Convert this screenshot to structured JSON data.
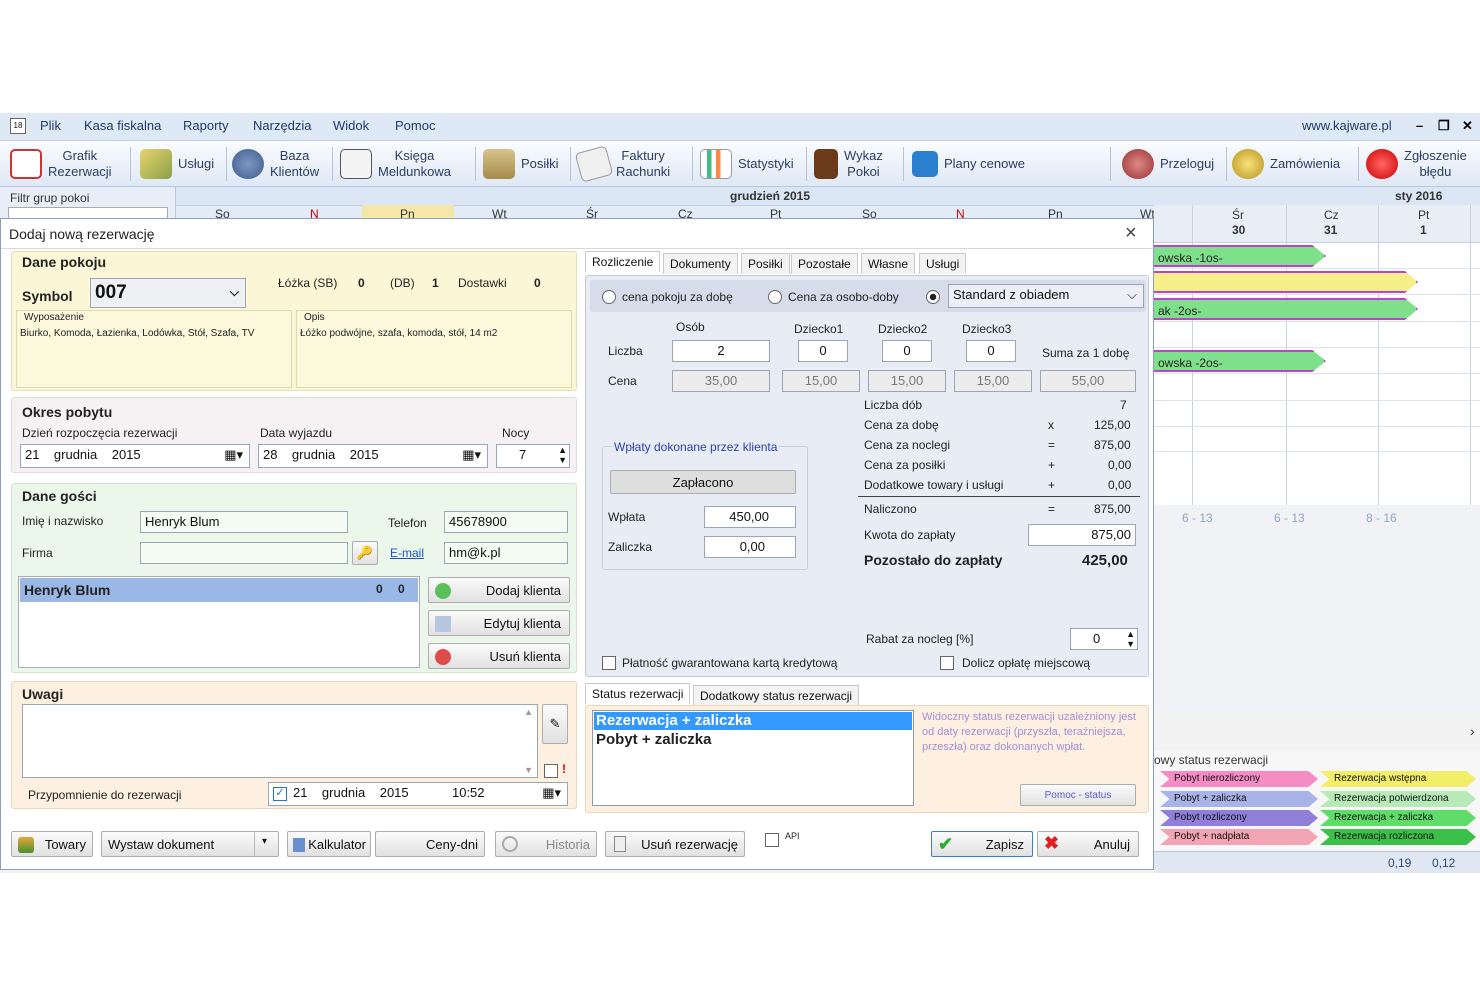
{
  "menu": {
    "items": [
      "Plik",
      "Kasa fiskalna",
      "Raporty",
      "Narzędzia",
      "Widok",
      "Pomoc"
    ],
    "site": "www.kajware.pl"
  },
  "toolbar": {
    "grafik": "Grafik\nRezerwacji",
    "uslugi": "Usługi",
    "baza": "Baza\nKlientów",
    "ksiega": "Księga\nMeldunkowa",
    "posilki": "Posiłki",
    "faktury": "Faktury\nRachunki",
    "statystyki": "Statystyki",
    "wykaz": "Wykaz\nPokoi",
    "plany": "Plany cenowe",
    "przeloguj": "Przeloguj",
    "zamowienia": "Zamówienia",
    "zgloszenie": "Zgłoszenie\nbłędu"
  },
  "calendar": {
    "filter_label": "Filtr grup pokoi",
    "month1": "grudzień 2015",
    "month2": "sty 2016",
    "days": [
      {
        "n": "Śr",
        "d": "30"
      },
      {
        "n": "Cz",
        "d": "31"
      },
      {
        "n": "Pt",
        "d": "1"
      }
    ],
    "top_days": [
      "So",
      "N",
      "Pn",
      "Wt",
      "Śr",
      "Cz",
      "Pt",
      "So",
      "N",
      "Pn",
      "Wt"
    ],
    "bars": [
      "owska -1os-",
      "ak -2os-",
      "owska -2os-"
    ],
    "ranges": [
      "6 - 13",
      "6 - 13",
      "8 - 16"
    ],
    "status_label": "owy status rezerwacji",
    "legend_left": [
      "Pobyt nierozliczony",
      "Pobyt + zaliczka",
      "Pobyt rozliczony",
      "Pobyt + nadpłata"
    ],
    "legend_right": [
      "Rezerwacja wstępna",
      "Rezerwacja potwierdzona",
      "Rezerwacja + zaliczka",
      "Rezerwacja rozliczona"
    ],
    "bottom_vals": [
      "0,19",
      "0,12"
    ]
  },
  "dialog": {
    "title": "Dodaj nową rezerwację",
    "room": {
      "title": "Dane pokoju",
      "symbol_label": "Symbol",
      "symbol": "007",
      "lozka_sb_label": "Łóżka (SB)",
      "lozka_sb": "0",
      "db_label": "(DB)",
      "db": "1",
      "dostawki_label": "Dostawki",
      "dostawki": "0",
      "wyposazenie_label": "Wyposażenie",
      "wyposazenie": "Biurko, Komoda, Łazienka, Lodówka, Stół, Szafa, TV",
      "opis_label": "Opis",
      "opis": "Łóżko podwójne, szafa, komoda, stół, 14 m2"
    },
    "stay": {
      "title": "Okres pobytu",
      "start_label": "Dzień rozpoczęcia rezerwacji",
      "start": "21    grudnia    2015",
      "end_label": "Data wyjazdu",
      "end": "28    grudnia    2015",
      "nights_label": "Nocy",
      "nights": "7"
    },
    "guests": {
      "title": "Dane gości",
      "name_label": "Imię i nazwisko",
      "name": "Henryk Blum",
      "phone_label": "Telefon",
      "phone": "45678900",
      "firma_label": "Firma",
      "firma": "",
      "email_label": "E-mail",
      "email": "hm@k.pl",
      "guest_row": "Henryk Blum",
      "guest_c1": "0",
      "guest_c2": "0",
      "add": "Dodaj klienta",
      "edit": "Edytuj klienta",
      "remove": "Usuń klienta"
    },
    "notes": {
      "title": "Uwagi",
      "reminder_label": "Przypomnienie do rezerwacji",
      "reminder": "21    grudnia    2015            10:52"
    },
    "tabs": [
      "Rozliczenie",
      "Dokumenty",
      "Posiłki",
      "Pozostałe",
      "Własne",
      "Usługi"
    ],
    "billing": {
      "opt1": "cena pokoju za dobę",
      "opt2": "Cena za osobo-doby",
      "opt3": "Standard z obiadem",
      "cols": [
        "Osób",
        "Dziecko1",
        "Dziecko2",
        "Dziecko3"
      ],
      "liczba_label": "Liczba",
      "liczba": [
        "2",
        "0",
        "0",
        "0"
      ],
      "cena_label": "Cena",
      "cena": [
        "35,00",
        "15,00",
        "15,00",
        "15,00"
      ],
      "suma_label": "Suma za 1 dobę",
      "suma": "55,00",
      "summary": [
        {
          "l": "Liczba dób",
          "op": "",
          "v": "7"
        },
        {
          "l": "Cena za dobę",
          "op": "x",
          "v": "125,00"
        },
        {
          "l": "Cena za noclegi",
          "op": "=",
          "v": "875,00"
        },
        {
          "l": "Cena za posiłki",
          "op": "+",
          "v": "0,00"
        },
        {
          "l": "Dodatkowe towary i usługi",
          "op": "+",
          "v": "0,00"
        }
      ],
      "naliczono_label": "Naliczono",
      "naliczono": "875,00",
      "kwota_label": "Kwota do zapłaty",
      "kwota": "875,00",
      "pozostalo_label": "Pozostało do zapłaty",
      "pozostalo": "425,00",
      "wplaty_title": "Wpłaty dokonane przez klienta",
      "zaplacono": "Zapłacono",
      "wplata_label": "Wpłata",
      "wplata": "450,00",
      "zaliczka_label": "Zaliczka",
      "zaliczka": "0,00",
      "rabat_label": "Rabat za nocleg [%]",
      "rabat": "0",
      "platnosc": "Płatność gwarantowana kartą kredytową",
      "dolicz": "Dolicz opłatę miejscową"
    },
    "status": {
      "tabs": [
        "Status rezerwacji",
        "Dodatkowy status rezerwacji"
      ],
      "items": [
        "Rezerwacja + zaliczka",
        "Pobyt + zaliczka"
      ],
      "note": "Widoczny status rezerwacji uzależniony jest od daty rezerwacji (przyszła, teraźniejsza, przeszła) oraz dokonanych wpłat.",
      "help": "Pomoc - status"
    },
    "bottom": {
      "towary": "Towary",
      "wystaw": "Wystaw dokument",
      "kalkulator": "Kalkulator",
      "ceny": "Ceny-dni",
      "historia": "Historia",
      "usun": "Usuń rezerwację",
      "api": "API",
      "zapisz": "Zapisz",
      "anuluj": "Anuluj"
    }
  },
  "colors": {
    "accent": "#3399ff",
    "bar_green": "#7ee08a",
    "bar_border": "#c23fd6",
    "bar_yellow": "#f5ef8a"
  }
}
